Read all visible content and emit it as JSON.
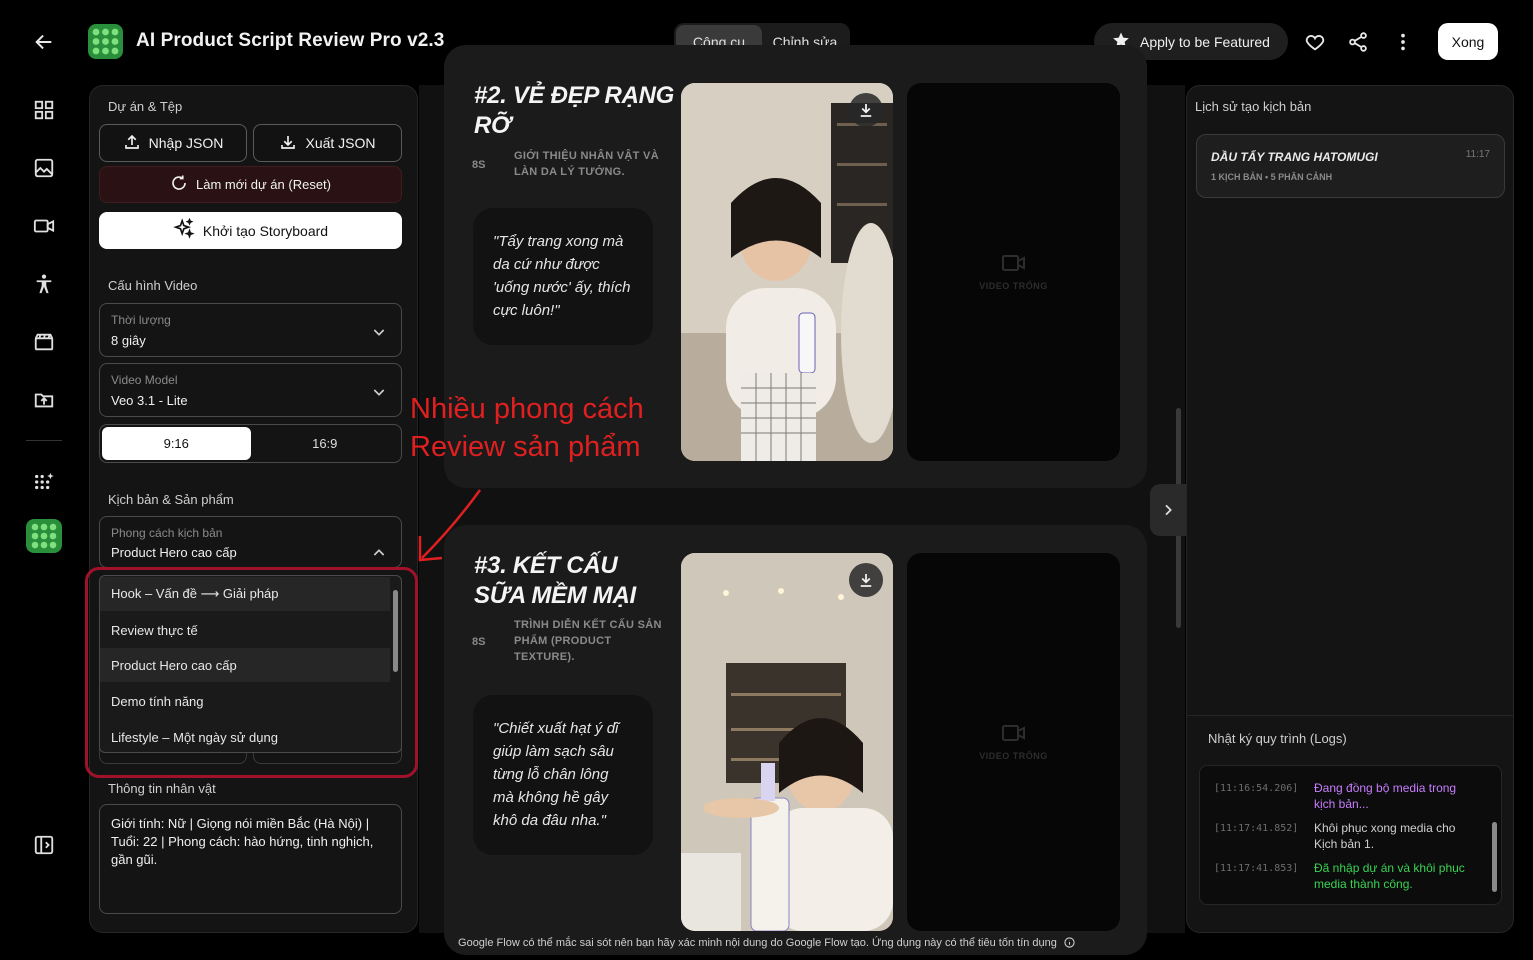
{
  "header": {
    "app_title": "AI Product Script Review Pro v2.3",
    "tabs": [
      "Công cụ",
      "Chỉnh sửa"
    ],
    "featured_label": "Apply to be Featured",
    "done_label": "Xong"
  },
  "sidebar": {
    "project_section": "Dự án & Tệp",
    "import_json": "Nhập JSON",
    "export_json": "Xuất JSON",
    "reset_project": "Làm mới dự án (Reset)",
    "generate_storyboard": "Khởi tạo Storyboard",
    "video_section": "Cấu hình Video",
    "duration_label": "Thời lượng",
    "duration_value": "8 giây",
    "model_label": "Video Model",
    "model_value": "Veo 3.1 - Lite",
    "ratio_options": [
      "9:16",
      "16:9"
    ],
    "script_section": "Kịch bản & Sản phẩm",
    "style_label": "Phong cách kịch bản",
    "style_value": "Product Hero cao cấp",
    "style_options": [
      "Hook – Vấn đề ⟶ Giải pháp",
      "Review thực tế",
      "Product Hero cao cấp",
      "Demo tính năng",
      "Lifestyle – Một ngày sử dụng"
    ],
    "character_section": "Thông tin nhân vật",
    "character_info": "Giới tính: Nữ | Giọng nói miền Bắc (Hà Nội) | Tuổi: 22 | Phong cách: hào hứng, tinh nghịch, gần gũi."
  },
  "annotation": {
    "line1": "Nhiều phong cách",
    "line2": "Review sản phẩm"
  },
  "scenes": [
    {
      "title": "#2. VẺ ĐẸP RẠNG RỠ",
      "duration": "8S",
      "description": "Giới thiệu nhân vật và làn da lý tưởng.",
      "quote": "\"Tẩy trang xong mà da cứ như được 'uống nước' ấy, thích cực luôn!\"",
      "video_placeholder": "VIDEO TRỐNG"
    },
    {
      "title": "#3. KẾT CẤU SỮA MỀM MẠI",
      "duration": "8S",
      "description": "Trình diễn kết cấu sản phẩm (product texture).",
      "quote": "\"Chiết xuất hạt ý dĩ giúp làm sạch sâu từng lỗ chân lông mà không hề gây khô da đâu nha.\"",
      "video_placeholder": "VIDEO TRỐNG"
    }
  ],
  "history": {
    "title": "Lịch sử tạo kịch bản",
    "items": [
      {
        "name": "DẦU TẨY TRANG HATOMUGI",
        "time": "11:17",
        "meta": "1 KỊCH BẢN • 5 PHÂN CẢNH"
      }
    ]
  },
  "logs": {
    "title": "Nhật ký quy trình (Logs)",
    "entries": [
      {
        "ts": "[11:16:54.206]",
        "msg": "Đang đồng bộ media trong kịch bản...",
        "color": "#c77dff"
      },
      {
        "ts": "[11:17:41.852]",
        "msg": "Khôi phục xong media cho Kịch bản 1.",
        "color": "#cfcfcf"
      },
      {
        "ts": "[11:17:41.853]",
        "msg": "Đã nhập dự án và khôi phục media thành công.",
        "color": "#39d353"
      }
    ]
  },
  "footer": {
    "disclaimer": "Google Flow có thể mắc sai sót nên bạn hãy xác minh nội dung do Google Flow tạo. Ứng dụng này có thể tiêu tốn tín dụng"
  },
  "colors": {
    "accent_red": "#e02020",
    "highlight_border": "#a1122a",
    "log_purple": "#c77dff",
    "log_green": "#39d353"
  }
}
